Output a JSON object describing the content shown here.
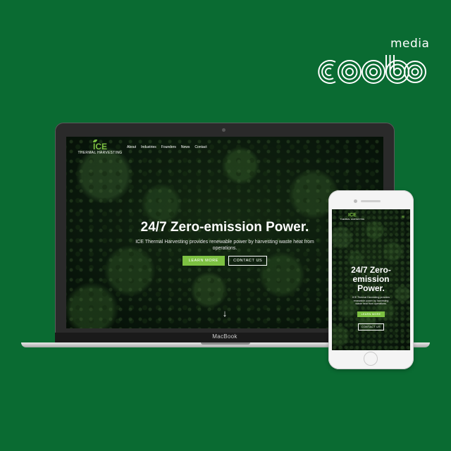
{
  "brand": {
    "name": "coobo",
    "suffix": "media"
  },
  "laptop": {
    "device_label": "MacBook",
    "site": {
      "logo_main": "ICE",
      "logo_sub": "THERMAL HARVESTING",
      "nav": [
        "About",
        "Industries",
        "Founders",
        "News",
        "Contact"
      ],
      "hero_title": "24/7 Zero-emission Power.",
      "hero_text": "ICE Thermal Harvesting provides renewable power by harvesting waste heat from operations.",
      "learn_more": "LEARN MORE",
      "contact_us": "CONTACT US",
      "scroll_arrow": "↓"
    }
  },
  "phone": {
    "site": {
      "logo_main": "ICE",
      "logo_sub": "THERMAL HARVESTING",
      "menu_icon": "≡",
      "hero_title": "24/7 Zero-emission Power.",
      "hero_text": "ICE Thermal Harvesting provides renewable power by harvesting waste heat from operations.",
      "learn_more": "LEARN MORE",
      "contact_us": "CONTACT US"
    }
  },
  "colors": {
    "background": "#0a6b32",
    "accent": "#7dc142",
    "text": "#ffffff"
  }
}
